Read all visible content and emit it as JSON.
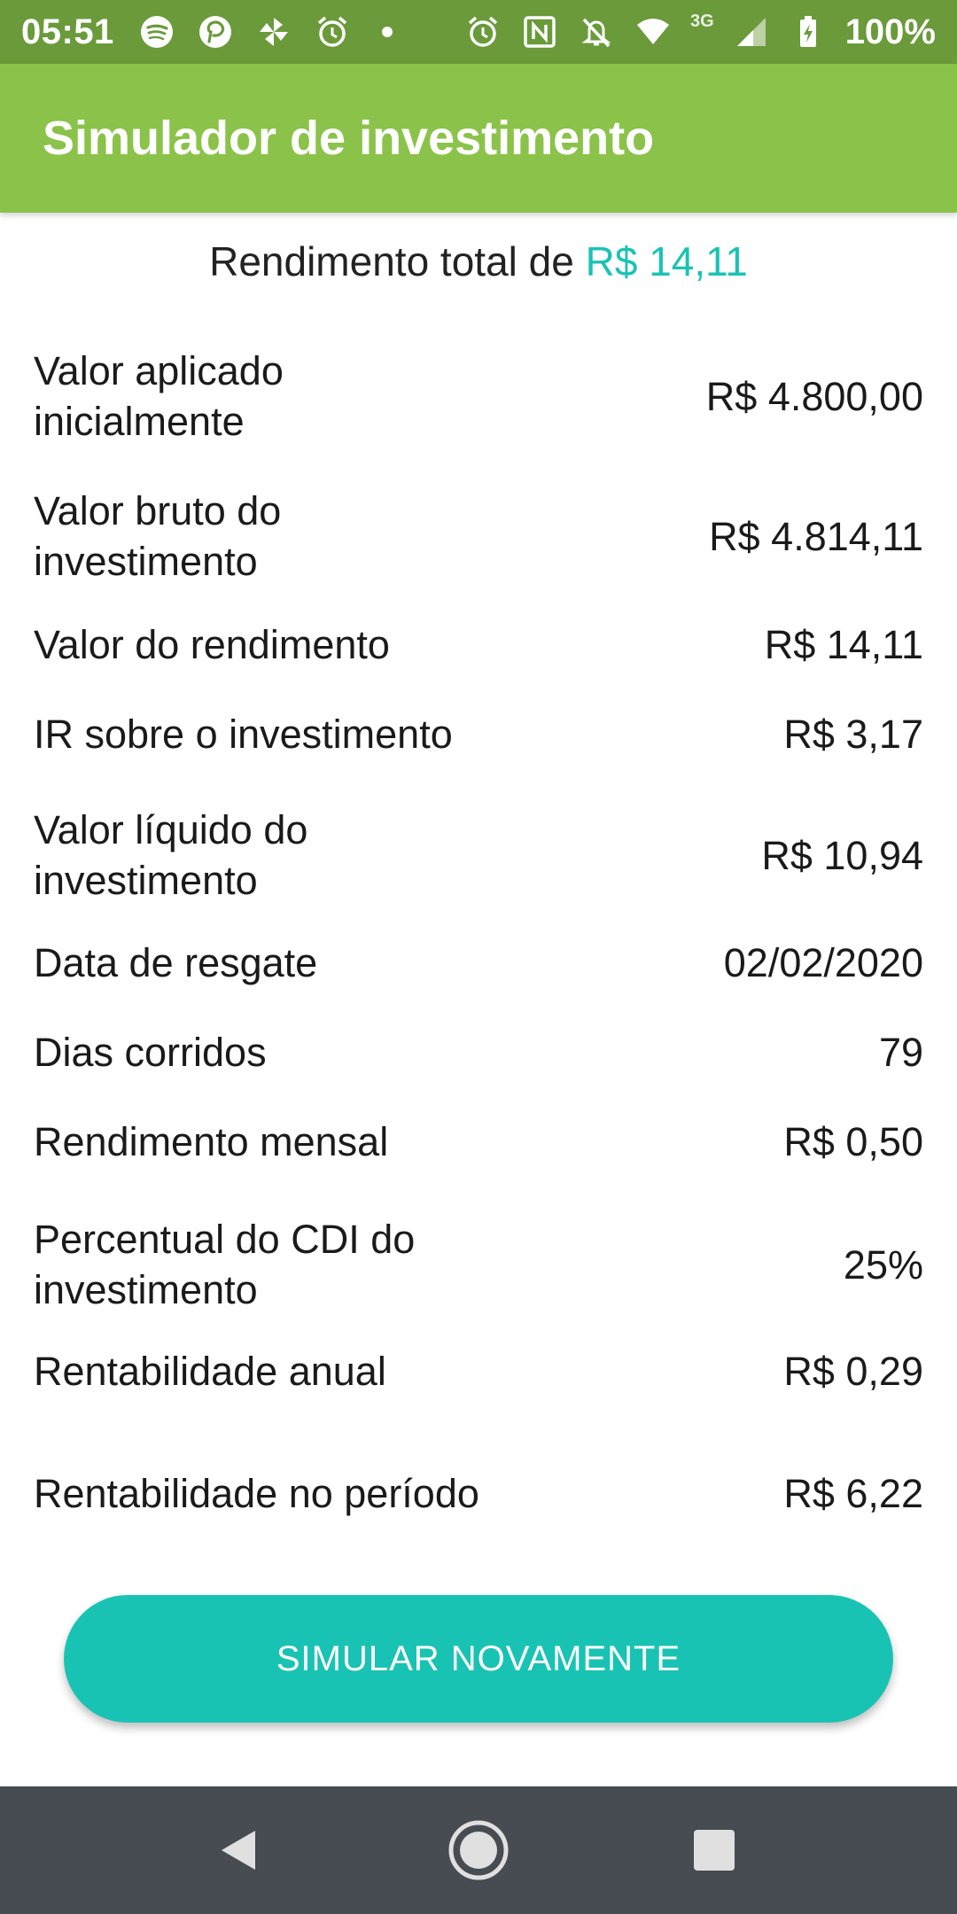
{
  "status_bar": {
    "time": "05:51",
    "battery": "100%",
    "network": "3G",
    "left_icons": [
      "spotify-icon",
      "pinterest-icon",
      "pinwheel-icon",
      "alarm-icon"
    ],
    "right_icons": [
      "alarm-icon",
      "nfc-icon",
      "mute-icon",
      "wifi-icon",
      "signal-icon",
      "battery-icon"
    ]
  },
  "app_bar": {
    "title": "Simulador de investimento"
  },
  "summary": {
    "prefix": "Rendimento total de ",
    "amount": "R$ 14,11",
    "accent_color": "#19c3b3"
  },
  "results": [
    {
      "label": "Valor aplicado inicialmente",
      "value": "R$ 4.800,00"
    },
    {
      "label": "Valor bruto do investimento",
      "value": "R$ 4.814,11"
    },
    {
      "label": "Valor do rendimento",
      "value": "R$ 14,11"
    },
    {
      "label": "IR sobre o investimento",
      "value": "R$ 3,17"
    },
    {
      "label": "Valor líquido do investimento",
      "value": "R$ 10,94"
    },
    {
      "label": "Data de resgate",
      "value": "02/02/2020"
    },
    {
      "label": "Dias corridos",
      "value": "79"
    },
    {
      "label": "Rendimento mensal",
      "value": "R$ 0,50"
    },
    {
      "label": "Percentual do CDI do investimento",
      "value": "25%"
    },
    {
      "label": "Rentabilidade anual",
      "value": "R$ 0,29"
    },
    {
      "label": "Rentabilidade no período",
      "value": "R$ 6,22"
    }
  ],
  "button": {
    "label": "SIMULAR NOVAMENTE",
    "color": "#19c3b3"
  },
  "nav": {
    "icons": [
      "back-icon",
      "home-icon",
      "recents-icon"
    ]
  },
  "colors": {
    "status_bar": "#6a9a3a",
    "app_bar": "#8bc34a",
    "nav_bar": "#474c52"
  }
}
